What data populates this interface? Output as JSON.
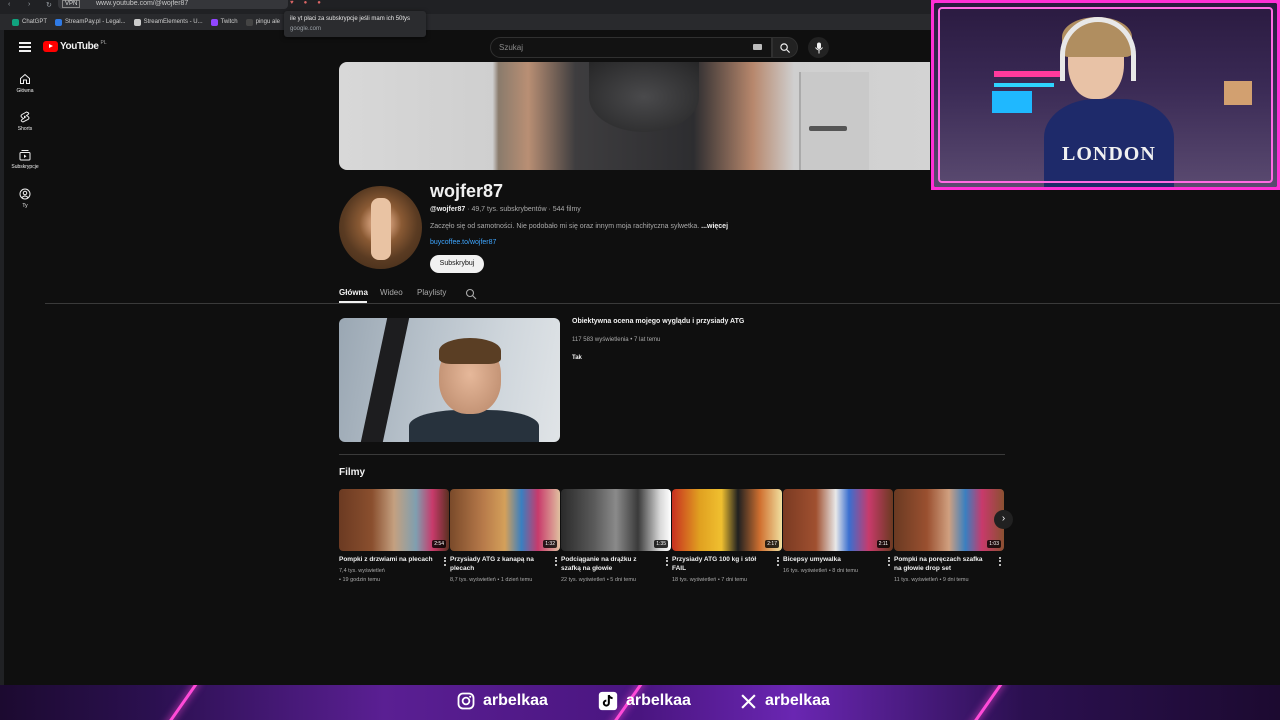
{
  "browser": {
    "url": "www.youtube.com/@wojfer87",
    "vpn_label": "VPN",
    "bookmarks": [
      {
        "label": "ChatGPT",
        "color": "#10a37f"
      },
      {
        "label": "StreamPay.pl - Legal...",
        "color": "#2f7ae5"
      },
      {
        "label": "StreamElements - U...",
        "color": "#cccccc"
      },
      {
        "label": "Twitch",
        "color": "#9146ff"
      },
      {
        "label": "pingu ale",
        "color": "#444444"
      }
    ],
    "tooltip": {
      "text": "ile yt płaci za subskrypcje jeśli mam ich 50tys",
      "source": "google.com"
    }
  },
  "youtube": {
    "logo_word": "YouTube",
    "logo_country": "PL",
    "search_placeholder": "Szukaj",
    "sidebar": [
      {
        "label": "Główna",
        "icon": "home-icon"
      },
      {
        "label": "Shorts",
        "icon": "shorts-icon"
      },
      {
        "label": "Subskrypcje",
        "icon": "subscriptions-icon"
      },
      {
        "label": "Ty",
        "icon": "you-icon"
      }
    ],
    "channel": {
      "name": "wojfer87",
      "handle": "@wojfer87",
      "meta": " · 49,7 tys. subskrybentów · 544 filmy",
      "description": "Zaczęło się od samotności. Nie podobało mi się oraz innym moja rachityczna sylwetka. ",
      "more_label": "...więcej",
      "link": "buycoffee.to/wojfer87",
      "subscribe_label": "Subskrybuj"
    },
    "tabs": [
      "Główna",
      "Wideo",
      "Playlisty"
    ],
    "featured": {
      "title": "Obiektywna ocena mojego wyglądu i przysiady ATG",
      "meta": "117 583 wyświetlenia • 7 lat temu",
      "description": "Tak"
    },
    "section_title": "Filmy",
    "videos": [
      {
        "title": "Pompki z drzwiami na plecach",
        "meta": "7,4 tys. wyświetleń\n• 19 godzin temu",
        "duration": "2:54"
      },
      {
        "title": "Przysiady ATG z kanapą na plecach",
        "meta": "8,7 tys. wyświetleń • 1 dzień temu",
        "duration": "1:32"
      },
      {
        "title": "Podciąganie na drążku z szafką na głowie",
        "meta": "22 tys. wyświetleń • 5 dni temu",
        "duration": "1:35"
      },
      {
        "title": "Przysiady ATG 100 kg i stół FAIL",
        "meta": "18 tys. wyświetleń • 7 dni temu",
        "duration": "2:17"
      },
      {
        "title": "Bicepsy umywalka",
        "meta": "16 tys. wyświetleń • 8 dni temu",
        "duration": "2:11"
      },
      {
        "title": "Pompki na poręczach szafka na głowie drop set",
        "meta": "11 tys. wyświetleń • 9 dni temu",
        "duration": "1:03"
      }
    ]
  },
  "webcam": {
    "shirt_text": "LONDON"
  },
  "social": [
    {
      "platform": "instagram-icon",
      "handle": "arbelkaa"
    },
    {
      "platform": "tiktok-icon",
      "handle": "arbelkaa"
    },
    {
      "platform": "x-icon",
      "handle": "arbelkaa"
    }
  ]
}
